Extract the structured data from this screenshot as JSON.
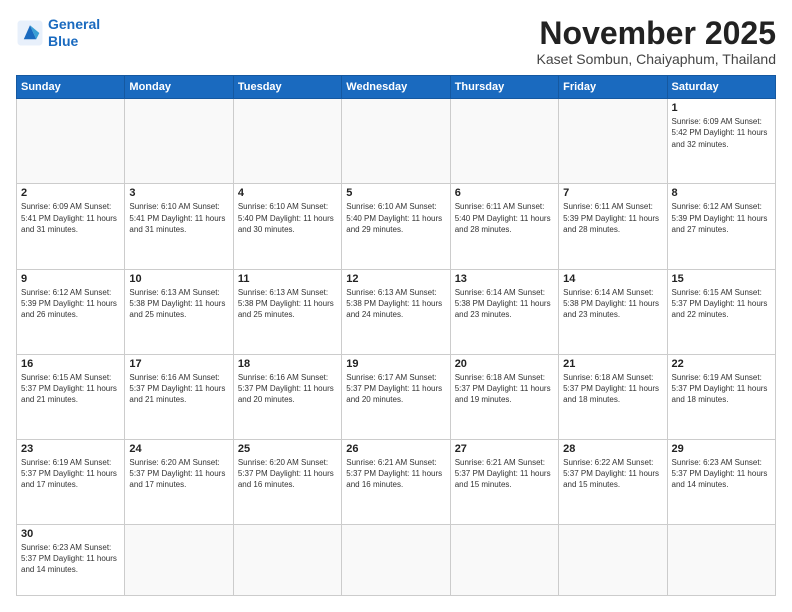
{
  "logo": {
    "line1": "General",
    "line2": "Blue"
  },
  "header": {
    "title": "November 2025",
    "subtitle": "Kaset Sombun, Chaiyaphum, Thailand"
  },
  "weekdays": [
    "Sunday",
    "Monday",
    "Tuesday",
    "Wednesday",
    "Thursday",
    "Friday",
    "Saturday"
  ],
  "weeks": [
    [
      {
        "day": "",
        "info": ""
      },
      {
        "day": "",
        "info": ""
      },
      {
        "day": "",
        "info": ""
      },
      {
        "day": "",
        "info": ""
      },
      {
        "day": "",
        "info": ""
      },
      {
        "day": "",
        "info": ""
      },
      {
        "day": "1",
        "info": "Sunrise: 6:09 AM\nSunset: 5:42 PM\nDaylight: 11 hours\nand 32 minutes."
      }
    ],
    [
      {
        "day": "2",
        "info": "Sunrise: 6:09 AM\nSunset: 5:41 PM\nDaylight: 11 hours\nand 31 minutes."
      },
      {
        "day": "3",
        "info": "Sunrise: 6:10 AM\nSunset: 5:41 PM\nDaylight: 11 hours\nand 31 minutes."
      },
      {
        "day": "4",
        "info": "Sunrise: 6:10 AM\nSunset: 5:40 PM\nDaylight: 11 hours\nand 30 minutes."
      },
      {
        "day": "5",
        "info": "Sunrise: 6:10 AM\nSunset: 5:40 PM\nDaylight: 11 hours\nand 29 minutes."
      },
      {
        "day": "6",
        "info": "Sunrise: 6:11 AM\nSunset: 5:40 PM\nDaylight: 11 hours\nand 28 minutes."
      },
      {
        "day": "7",
        "info": "Sunrise: 6:11 AM\nSunset: 5:39 PM\nDaylight: 11 hours\nand 28 minutes."
      },
      {
        "day": "8",
        "info": "Sunrise: 6:12 AM\nSunset: 5:39 PM\nDaylight: 11 hours\nand 27 minutes."
      }
    ],
    [
      {
        "day": "9",
        "info": "Sunrise: 6:12 AM\nSunset: 5:39 PM\nDaylight: 11 hours\nand 26 minutes."
      },
      {
        "day": "10",
        "info": "Sunrise: 6:13 AM\nSunset: 5:38 PM\nDaylight: 11 hours\nand 25 minutes."
      },
      {
        "day": "11",
        "info": "Sunrise: 6:13 AM\nSunset: 5:38 PM\nDaylight: 11 hours\nand 25 minutes."
      },
      {
        "day": "12",
        "info": "Sunrise: 6:13 AM\nSunset: 5:38 PM\nDaylight: 11 hours\nand 24 minutes."
      },
      {
        "day": "13",
        "info": "Sunrise: 6:14 AM\nSunset: 5:38 PM\nDaylight: 11 hours\nand 23 minutes."
      },
      {
        "day": "14",
        "info": "Sunrise: 6:14 AM\nSunset: 5:38 PM\nDaylight: 11 hours\nand 23 minutes."
      },
      {
        "day": "15",
        "info": "Sunrise: 6:15 AM\nSunset: 5:37 PM\nDaylight: 11 hours\nand 22 minutes."
      }
    ],
    [
      {
        "day": "16",
        "info": "Sunrise: 6:15 AM\nSunset: 5:37 PM\nDaylight: 11 hours\nand 21 minutes."
      },
      {
        "day": "17",
        "info": "Sunrise: 6:16 AM\nSunset: 5:37 PM\nDaylight: 11 hours\nand 21 minutes."
      },
      {
        "day": "18",
        "info": "Sunrise: 6:16 AM\nSunset: 5:37 PM\nDaylight: 11 hours\nand 20 minutes."
      },
      {
        "day": "19",
        "info": "Sunrise: 6:17 AM\nSunset: 5:37 PM\nDaylight: 11 hours\nand 20 minutes."
      },
      {
        "day": "20",
        "info": "Sunrise: 6:18 AM\nSunset: 5:37 PM\nDaylight: 11 hours\nand 19 minutes."
      },
      {
        "day": "21",
        "info": "Sunrise: 6:18 AM\nSunset: 5:37 PM\nDaylight: 11 hours\nand 18 minutes."
      },
      {
        "day": "22",
        "info": "Sunrise: 6:19 AM\nSunset: 5:37 PM\nDaylight: 11 hours\nand 18 minutes."
      }
    ],
    [
      {
        "day": "23",
        "info": "Sunrise: 6:19 AM\nSunset: 5:37 PM\nDaylight: 11 hours\nand 17 minutes."
      },
      {
        "day": "24",
        "info": "Sunrise: 6:20 AM\nSunset: 5:37 PM\nDaylight: 11 hours\nand 17 minutes."
      },
      {
        "day": "25",
        "info": "Sunrise: 6:20 AM\nSunset: 5:37 PM\nDaylight: 11 hours\nand 16 minutes."
      },
      {
        "day": "26",
        "info": "Sunrise: 6:21 AM\nSunset: 5:37 PM\nDaylight: 11 hours\nand 16 minutes."
      },
      {
        "day": "27",
        "info": "Sunrise: 6:21 AM\nSunset: 5:37 PM\nDaylight: 11 hours\nand 15 minutes."
      },
      {
        "day": "28",
        "info": "Sunrise: 6:22 AM\nSunset: 5:37 PM\nDaylight: 11 hours\nand 15 minutes."
      },
      {
        "day": "29",
        "info": "Sunrise: 6:23 AM\nSunset: 5:37 PM\nDaylight: 11 hours\nand 14 minutes."
      }
    ],
    [
      {
        "day": "30",
        "info": "Sunrise: 6:23 AM\nSunset: 5:37 PM\nDaylight: 11 hours\nand 14 minutes."
      },
      {
        "day": "",
        "info": ""
      },
      {
        "day": "",
        "info": ""
      },
      {
        "day": "",
        "info": ""
      },
      {
        "day": "",
        "info": ""
      },
      {
        "day": "",
        "info": ""
      },
      {
        "day": "",
        "info": ""
      }
    ]
  ]
}
